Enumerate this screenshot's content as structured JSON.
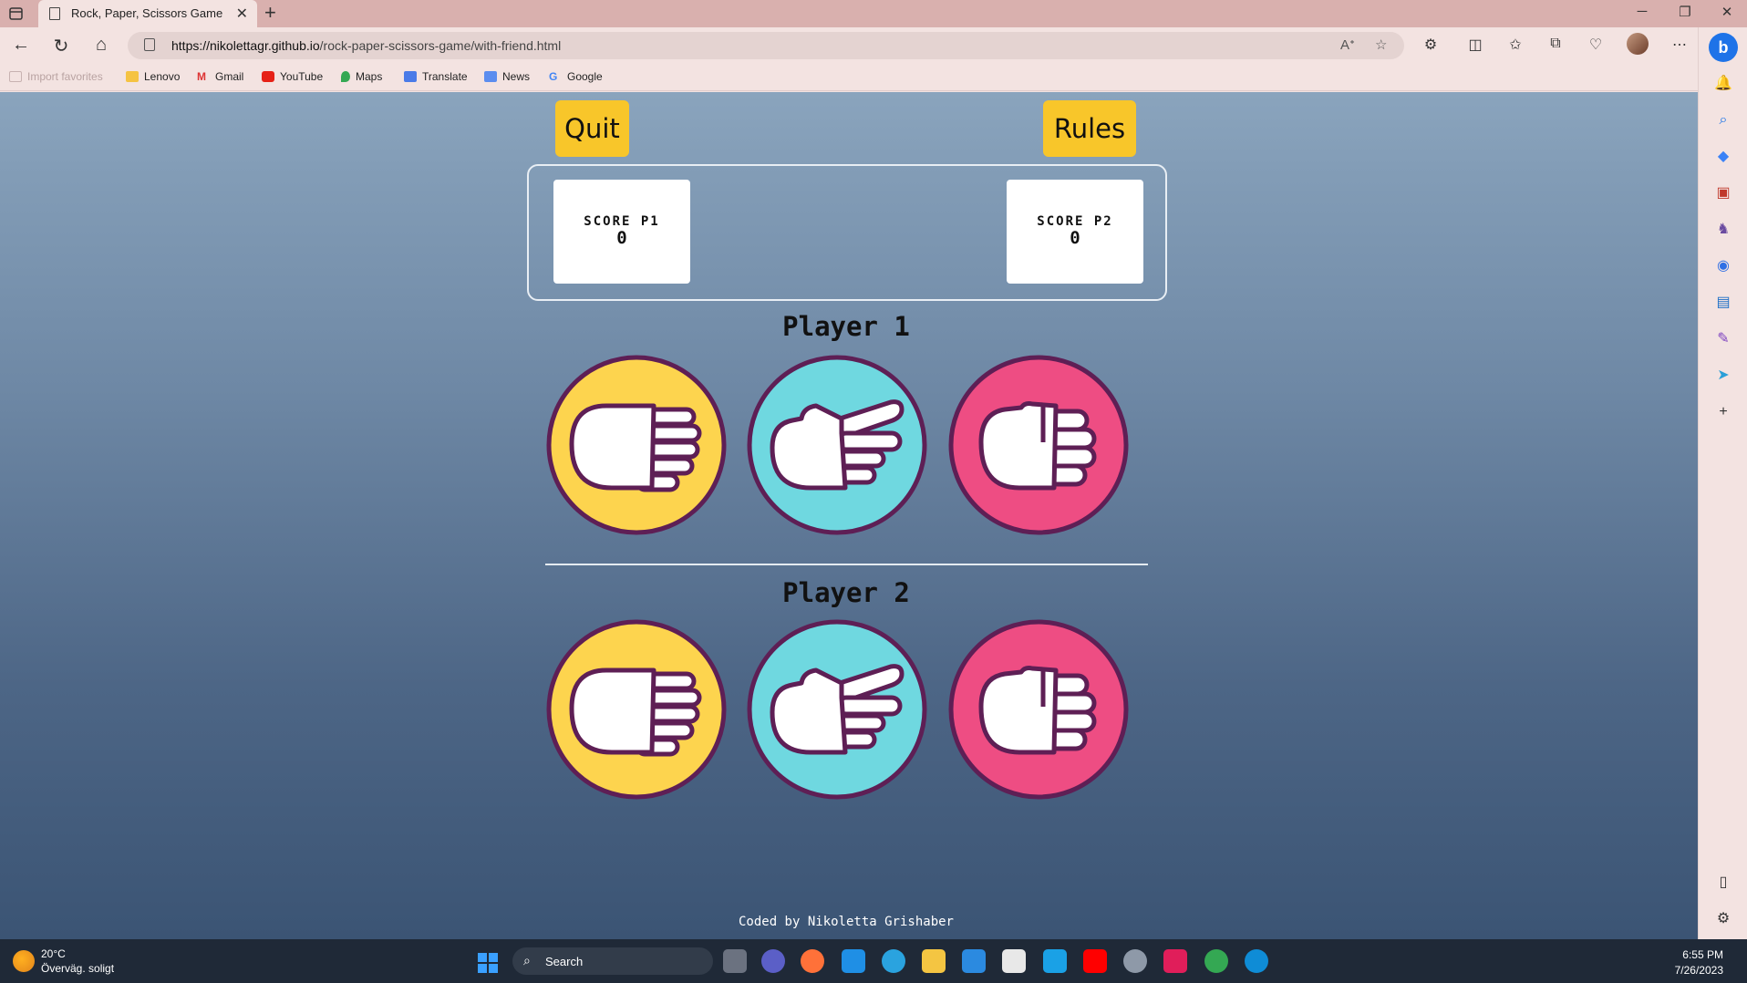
{
  "browser": {
    "tab_title": "Rock, Paper, Scissors Game",
    "url_host": "https://nikolettagr.github.io",
    "url_path": "/rock-paper-scissors-game/with-friend.html",
    "bookmarks": [
      "Import favorites",
      "Lenovo",
      "Gmail",
      "YouTube",
      "Maps",
      "Translate",
      "News",
      "Google"
    ]
  },
  "game": {
    "quit_label": "Quit",
    "rules_label": "Rules",
    "score_p1_label": "SCORE P1",
    "score_p1_value": "0",
    "score_p2_label": "SCORE P2",
    "score_p2_value": "0",
    "player1_title": "Player 1",
    "player2_title": "Player 2",
    "choices": [
      "paper",
      "scissors",
      "rock"
    ],
    "colors": {
      "paper": "#fdd44e",
      "scissors": "#6fd8e0",
      "rock": "#ee4d83",
      "outline": "#5e1f55",
      "button": "#f8c62a"
    },
    "footer": "Coded by Nikoletta Grishaber"
  },
  "taskbar": {
    "weather_temp": "20°C",
    "weather_desc": "Överväg. soligt",
    "search_label": "Search",
    "time": "6:55 PM",
    "date": "7/26/2023"
  }
}
